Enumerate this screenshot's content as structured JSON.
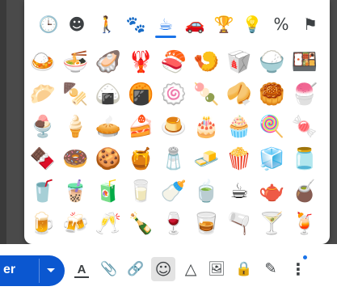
{
  "categories": [
    {
      "name": "recent-icon",
      "glyph": "🕒"
    },
    {
      "name": "smileys-icon",
      "glyph": "☻"
    },
    {
      "name": "people-icon",
      "glyph": "🚶"
    },
    {
      "name": "nature-icon",
      "glyph": "🐾"
    },
    {
      "name": "food-icon",
      "glyph": "☕"
    },
    {
      "name": "travel-icon",
      "glyph": "🚗"
    },
    {
      "name": "activities-icon",
      "glyph": "🏆"
    },
    {
      "name": "objects-icon",
      "glyph": "💡"
    },
    {
      "name": "symbols-icon",
      "glyph": "%"
    },
    {
      "name": "flags-icon",
      "glyph": "⚑"
    }
  ],
  "emoji_rows": [
    [
      "🍛",
      "🍜",
      "🦪",
      "🦞",
      "🍣",
      "🍤",
      "🥡",
      "🍚",
      "🍱"
    ],
    [
      "🥟",
      "🍢",
      "🍙",
      "🍘",
      "🍥",
      "🍡",
      "🥠",
      "🥮",
      "🍧"
    ],
    [
      "🍨",
      "🍦",
      "🥧",
      "🍰",
      "🍮",
      "🎂",
      "🧁",
      "🍭",
      "🍬"
    ],
    [
      "🍫",
      "🍩",
      "🍪",
      "🍯",
      "🧂",
      "🧈",
      "🍿",
      "🧊",
      "🫙"
    ],
    [
      "🥤",
      "🧋",
      "🧃",
      "🥛",
      "🍼",
      "🍵",
      "☕",
      "🫖",
      "🧉"
    ],
    [
      "🍺",
      "🍻",
      "🥂",
      "🍾",
      "🍷",
      "🥃",
      "🫗",
      "🍸",
      "🍹"
    ]
  ],
  "send": {
    "label": "er"
  },
  "toolbar": [
    {
      "name": "format-text-icon",
      "glyph": "A"
    },
    {
      "name": "attach-icon",
      "glyph": "📎"
    },
    {
      "name": "link-icon",
      "glyph": "🔗"
    },
    {
      "name": "emoji-icon",
      "glyph": "☺"
    },
    {
      "name": "drive-icon",
      "glyph": "△"
    },
    {
      "name": "image-icon",
      "glyph": "🖼"
    },
    {
      "name": "lock-clock-icon",
      "glyph": "🔒"
    },
    {
      "name": "signature-icon",
      "glyph": "✎"
    },
    {
      "name": "more-options-icon",
      "glyph": "⋮"
    }
  ]
}
